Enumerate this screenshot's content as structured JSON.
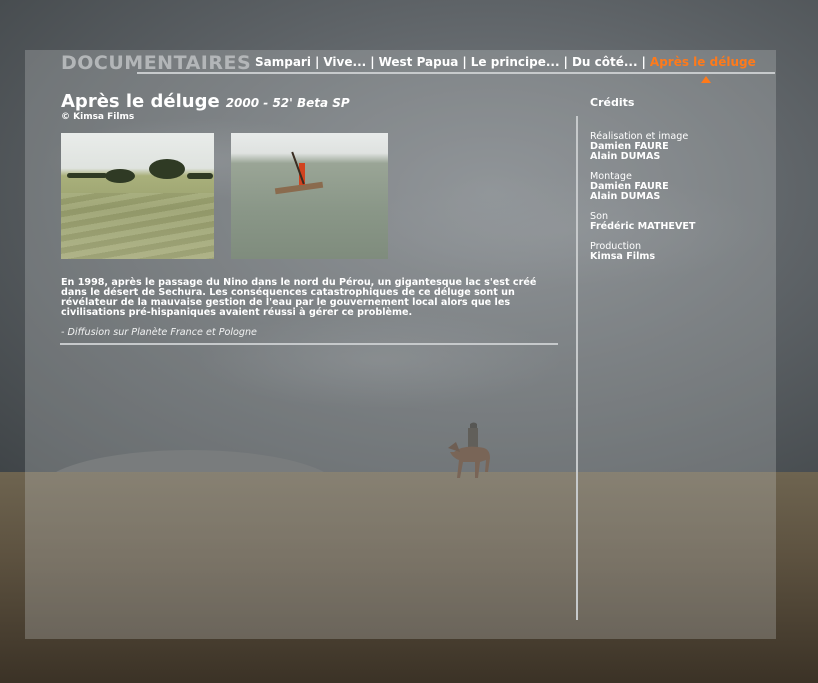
{
  "nav": {
    "brand": "DOCUMENTAIRES",
    "items": [
      {
        "label": "Sampari"
      },
      {
        "label": "Vive..."
      },
      {
        "label": "West Papua"
      },
      {
        "label": "Le principe..."
      },
      {
        "label": "Du côté..."
      },
      {
        "label": "Après le déluge"
      }
    ],
    "separator": "|",
    "active_index": 5
  },
  "film": {
    "title": "Après le déluge",
    "subtitle": "2000 - 52' Beta SP",
    "copyright": "©  Kimsa Films",
    "description": "En 1998, après le passage du Nino dans le nord du Pérou, un gigantesque lac s'est créé dans le désert de Sechura. Les conséquences catastrophiques de ce déluge sont un révélateur de la mauvaise gestion de l'eau par le gouvernement local alors que les civilisations pré-hispaniques avaient réussi à gérer ce problème.",
    "note": "- Diffusion sur Planète France et Pologne"
  },
  "credits": {
    "title": "Crédits",
    "roles": [
      {
        "role": "Réalisation et image",
        "names": [
          "Damien FAURE",
          "Alain DUMAS"
        ]
      },
      {
        "role": "Montage",
        "names": [
          "Damien FAURE",
          "Alain DUMAS"
        ]
      },
      {
        "role": "Son",
        "names": [
          "Frédéric MATHEVET"
        ]
      },
      {
        "role": "Production",
        "names": [
          "Kimsa Films"
        ]
      }
    ]
  },
  "colors": {
    "accent": "#ff7a1a",
    "text": "#ffffff",
    "brand": "#b3b6b8"
  }
}
